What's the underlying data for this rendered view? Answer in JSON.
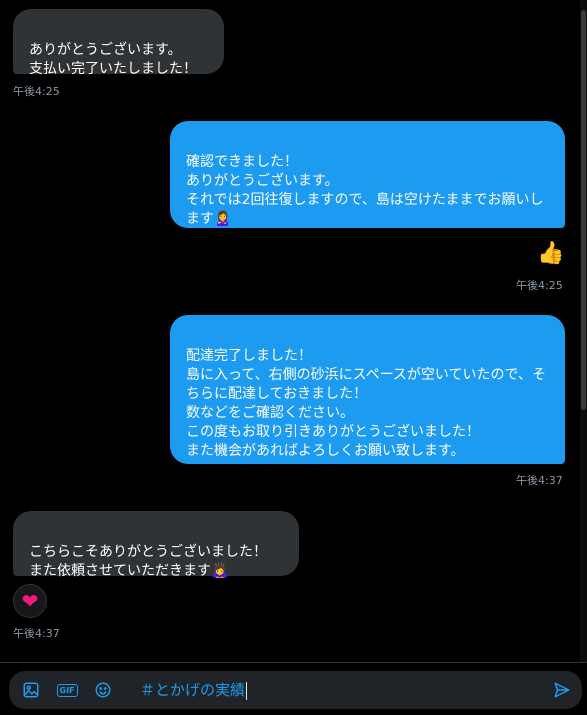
{
  "messages": [
    {
      "text": "ありがとうございます。\n支払い完了いたしました！",
      "time": "午後4:25"
    },
    {
      "text": "確認できました！\nありがとうございます。\nそれでは2回往復しますので、島は空けたままでお願いします🙎‍♀️"
    },
    {
      "reaction": "👍",
      "time": "午後4:25"
    },
    {
      "text": "配達完了しました！\n島に入って、右側の砂浜にスペースが空いていたので、そちらに配達しておきました！\n数などをご確認ください。\nこの度もお取り引きありがとうございました！\nまた機会があればよろしくお願い致します。",
      "time": "午後4:37"
    },
    {
      "text": "こちらこそありがとうございました！\nまた依頼させていただきます🙇‍♀️"
    },
    {
      "reaction": "❤",
      "time": "午後4:37"
    }
  ],
  "composer": {
    "text": "＃とかげの実績",
    "icons": [
      "image-icon",
      "gif-icon",
      "emoji-icon",
      "send-icon"
    ],
    "accent": "#1d9bf0"
  }
}
